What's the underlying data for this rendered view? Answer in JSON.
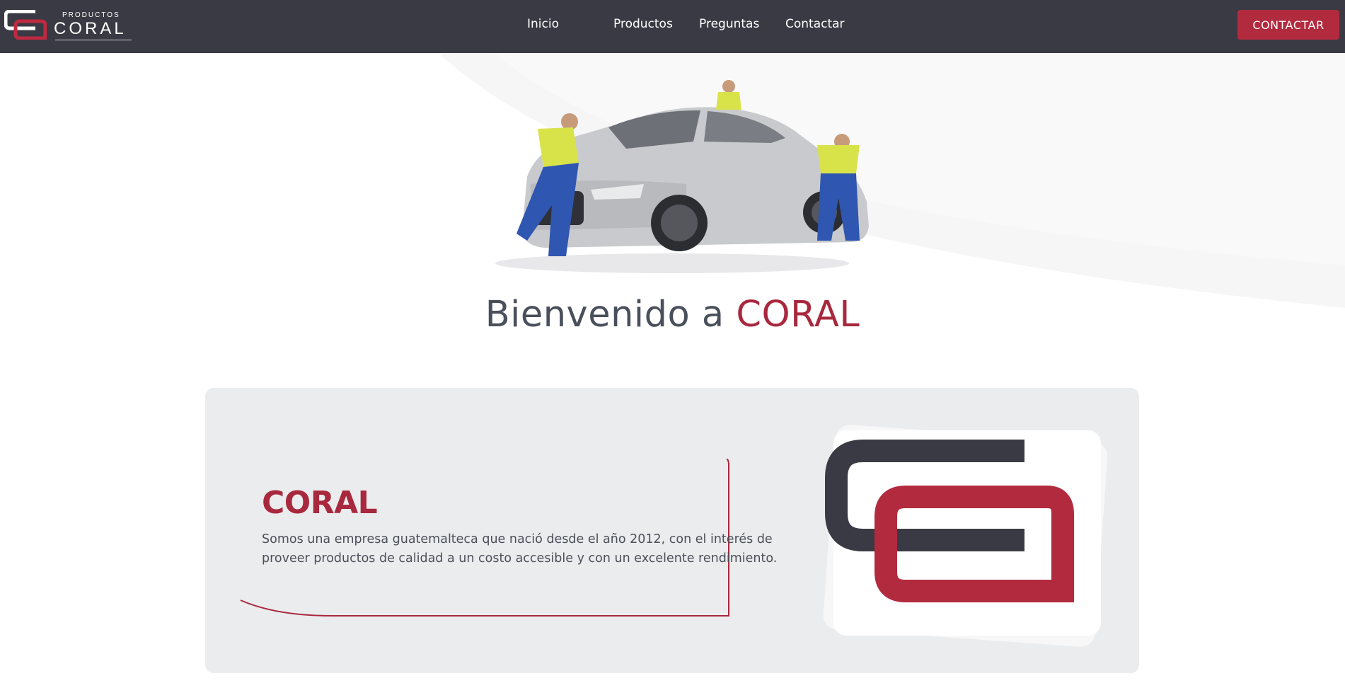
{
  "navbar": {
    "brand": {
      "small_text": "PRODUCTOS",
      "big_text": "CORAL",
      "icon": "coral-logo-icon"
    },
    "links": [
      {
        "label": "Inicio"
      },
      {
        "label": "Productos"
      },
      {
        "label": "Preguntas"
      },
      {
        "label": "Contactar"
      }
    ],
    "cta_label": "CONTACTAR"
  },
  "hero": {
    "image": "car-wash-workers-illustration",
    "title_prefix": "Bienvenido a ",
    "title_accent": "CORAL"
  },
  "about": {
    "title": "CORAL",
    "text": "Somos una empresa guatemalteca que nació desde el año 2012, con el interés de proveer productos de calidad a un costo accesible y con un excelente rendimiento.",
    "logo": "coral-logo-icon"
  },
  "colors": {
    "navbar_bg": "#3a3a44",
    "accent": "#b22a3e",
    "dark_logo": "#3a3a44",
    "card_bg": "#ebecee"
  }
}
